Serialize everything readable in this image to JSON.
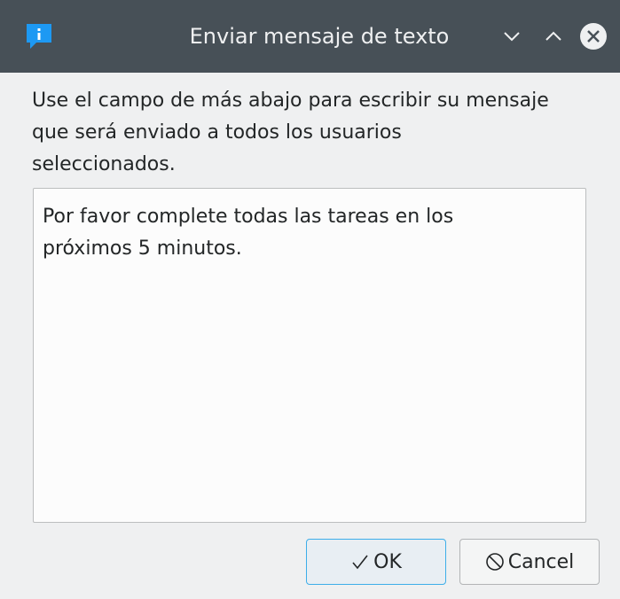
{
  "window": {
    "title": "Enviar mensaje de texto",
    "icon": "message-info-icon",
    "controls": [
      "minimize-icon",
      "maximize-icon",
      "close-icon"
    ]
  },
  "prompt": {
    "lines": [
      "Use el campo de más abajo para escribir su mensaje",
      "que será enviado a todos los usuarios",
      "seleccionados."
    ]
  },
  "message": {
    "lines": [
      "Por favor complete todas las tareas en los",
      "próximos 5 minutos."
    ]
  },
  "buttons": {
    "ok": {
      "label": "OK",
      "icon": "check-icon"
    },
    "cancel": {
      "label": "Cancel",
      "icon": "cancel-circle-icon"
    }
  },
  "colors": {
    "titlebar": "#475057",
    "window_bg": "#eff0f1",
    "accent": "#3daee9",
    "text": "#232627"
  }
}
